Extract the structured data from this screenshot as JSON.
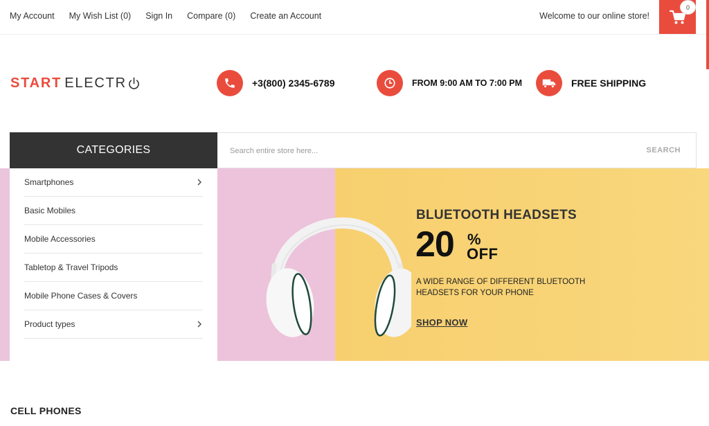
{
  "topbar": {
    "links": [
      "My Account",
      "My Wish List (0)",
      "Sign In",
      "Compare (0)",
      "Create an Account"
    ],
    "welcome": "Welcome to our online store!",
    "cart_count": "0"
  },
  "header": {
    "logo_part1": "START",
    "logo_part2": "ELECTR",
    "phone": "+3(800) 2345-6789",
    "hours": "FROM 9:00 AM TO 7:00 PM",
    "shipping": "FREE SHIPPING"
  },
  "categories": {
    "title": "CATEGORIES",
    "items": [
      {
        "label": "Smartphones"
      },
      {
        "label": "Basic Mobiles"
      },
      {
        "label": "Mobile Accessories"
      },
      {
        "label": "Tabletop & Travel Tripods"
      },
      {
        "label": "Mobile Phone Cases & Covers"
      },
      {
        "label": "Product types"
      }
    ]
  },
  "search": {
    "placeholder": "Search entire store here...",
    "button": "SEARCH"
  },
  "banner": {
    "title": "BLUETOOTH HEADSETS",
    "discount": "20",
    "percent": "%",
    "off": "OFF",
    "description": "A WIDE RANGE OF DIFFERENT BLUETOOTH HEADSETS FOR YOUR PHONE",
    "cta": "SHOP NOW"
  },
  "section": {
    "title": "CELL PHONES"
  },
  "colors": {
    "accent": "#e94c3d",
    "dark": "#333333",
    "banner_pink": "#ecc3da",
    "banner_yellow": "#f8d373"
  },
  "icons": [
    "cart-icon",
    "phone-icon",
    "clock-icon",
    "truck-icon",
    "chevron-right-icon",
    "power-icon"
  ]
}
